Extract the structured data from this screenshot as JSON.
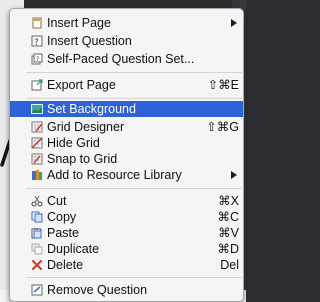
{
  "menu": {
    "items": [
      {
        "label": "Insert Page",
        "shortcut": "",
        "icon": "insert-page-icon",
        "submenu": true
      },
      {
        "label": "Insert Question",
        "shortcut": "",
        "icon": "insert-question-icon",
        "submenu": false
      },
      {
        "label": "Self-Paced Question Set...",
        "shortcut": "",
        "icon": "self-paced-question-set-icon",
        "submenu": false
      },
      {
        "label": "Export Page",
        "shortcut": "⇧⌘E",
        "icon": "export-page-icon",
        "submenu": false
      },
      {
        "label": "Set Background",
        "shortcut": "",
        "icon": "set-background-icon",
        "submenu": false,
        "highlighted": true
      },
      {
        "label": "Grid Designer",
        "shortcut": "⇧⌘G",
        "icon": "grid-designer-icon",
        "submenu": false
      },
      {
        "label": "Hide Grid",
        "shortcut": "",
        "icon": "hide-grid-icon",
        "submenu": false
      },
      {
        "label": "Snap to Grid",
        "shortcut": "",
        "icon": "snap-to-grid-icon",
        "submenu": false
      },
      {
        "label": "Add to Resource Library",
        "shortcut": "",
        "icon": "add-to-resource-library-icon",
        "submenu": true
      },
      {
        "label": "Cut",
        "shortcut": "⌘X",
        "icon": "scissors-icon",
        "submenu": false
      },
      {
        "label": "Copy",
        "shortcut": "⌘C",
        "icon": "copy-icon",
        "submenu": false
      },
      {
        "label": "Paste",
        "shortcut": "⌘V",
        "icon": "paste-icon",
        "submenu": false
      },
      {
        "label": "Duplicate",
        "shortcut": "⌘D",
        "icon": "duplicate-icon",
        "submenu": false
      },
      {
        "label": "Delete",
        "shortcut": "Del",
        "icon": "delete-x-icon",
        "submenu": false
      },
      {
        "label": "Remove Question",
        "shortcut": "",
        "icon": "remove-question-icon",
        "submenu": false
      }
    ]
  },
  "colors": {
    "highlight": "#2f62d6",
    "delete_icon": "#d9342b"
  }
}
